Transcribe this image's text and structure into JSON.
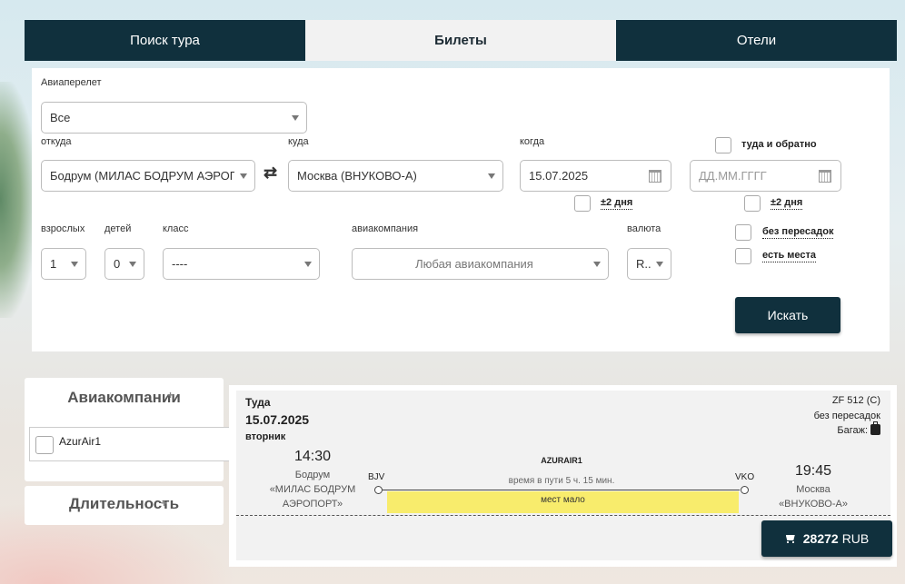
{
  "tabs": [
    {
      "label": "Поиск тура",
      "active": false
    },
    {
      "label": "Билеты",
      "active": true
    },
    {
      "label": "Отели",
      "active": false
    }
  ],
  "search": {
    "flight_type_label": "Авиаперелет",
    "flight_type_value": "Все",
    "from_label": "откуда",
    "from_value": "Бодрум (МИЛАС БОДРУМ АЭРОПОРТ)",
    "to_label": "куда",
    "to_value": "Москва (ВНУКОВО-А)",
    "swap_icon": "⇄",
    "when_label": "когда",
    "date_value": "15.07.2025",
    "return_placeholder": "ДД.ММ.ГГГГ",
    "roundtrip_label": "туда и обратно",
    "plusminus_label": "±2 дня",
    "plusminus_return_label": "±2 дня",
    "adults_label": "взрослых",
    "adults_value": "1",
    "children_label": "детей",
    "children_value": "0",
    "class_label": "класс",
    "class_value": "----",
    "airline_label": "авиакомпания",
    "airline_value": "Любая авиакомпания",
    "currency_label": "валюта",
    "currency_value": "R..",
    "nonstop_label": "без пересадок",
    "seats_label": "есть места",
    "search_button": "Искать"
  },
  "filters": {
    "airlines_title": "Авиакомпании",
    "airline_option": "AzurAir1",
    "duration_title": "Длительность",
    "plus_icon": "+"
  },
  "result": {
    "direction": "Туда",
    "date": "15.07.2025",
    "weekday": "вторник",
    "flight_code": "ZF 512 (C)",
    "transfers": "без пересадок",
    "baggage_label": "Багаж:",
    "departure_time": "14:30",
    "departure_city": "Бодрум",
    "departure_airport_line1": "«МИЛАС БОДРУМ",
    "departure_airport_line2": "АЭРОПОРТ»",
    "departure_code": "BJV",
    "airline": "AZURAIR1",
    "travel_time": "время в пути 5 ч. 15 мин.",
    "seats_notice": "мест мало",
    "arrival_code": "VKO",
    "arrival_time": "19:45",
    "arrival_city": "Москва",
    "arrival_airport": "«ВНУКОВО-А»",
    "price": "28272",
    "currency": "RUB"
  }
}
